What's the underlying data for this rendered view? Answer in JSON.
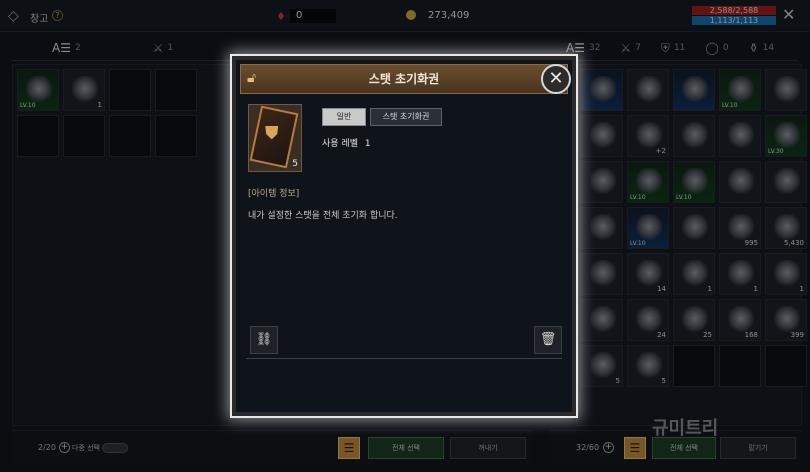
{
  "topbar": {
    "title": "창고",
    "help": "?",
    "ruby_value": "0",
    "gold_value": "273,409",
    "hp": "2,588/2,588",
    "mp": "1,113/1,113"
  },
  "left_tabs": [
    {
      "icon": "all-icon",
      "glyph": "A☰",
      "count": "2",
      "active": true
    },
    {
      "icon": "sword-icon",
      "glyph": "⚔",
      "count": "1",
      "active": false
    }
  ],
  "right_tabs": [
    {
      "icon": "all-icon",
      "glyph": "A☰",
      "count": "32",
      "active": true
    },
    {
      "icon": "sword-icon",
      "glyph": "⚔",
      "count": "7",
      "active": false
    },
    {
      "icon": "armor-icon",
      "glyph": "⛨",
      "count": "11",
      "active": false
    },
    {
      "icon": "ring-icon",
      "glyph": "◯",
      "count": "0",
      "active": false
    },
    {
      "icon": "potion-icon",
      "glyph": "⚱",
      "count": "14",
      "active": false
    }
  ],
  "left_items": [
    {
      "lv": "LV.10",
      "count": "",
      "tone": "green"
    },
    {
      "lv": "",
      "count": "1",
      "tone": "gray"
    }
  ],
  "right_items": [
    {
      "lv": "",
      "count": "",
      "tone": "blue"
    },
    {
      "lv": "",
      "count": "",
      "tone": "gray"
    },
    {
      "lv": "",
      "count": "",
      "tone": "blue"
    },
    {
      "lv": "LV.10",
      "count": "",
      "tone": "green"
    },
    {
      "lv": "",
      "count": "",
      "tone": "gray"
    },
    {
      "lv": "",
      "count": "",
      "tone": "gray"
    },
    {
      "lv": "",
      "count": "+2",
      "tone": "gray"
    },
    {
      "lv": "",
      "count": "",
      "tone": "gray"
    },
    {
      "lv": "",
      "count": "",
      "tone": "gray"
    },
    {
      "lv": "LV.30",
      "count": "",
      "tone": "green"
    },
    {
      "lv": "",
      "count": "",
      "tone": "gray"
    },
    {
      "lv": "LV.10",
      "count": "",
      "tone": "green"
    },
    {
      "lv": "LV.10",
      "count": "",
      "tone": "green"
    },
    {
      "lv": "",
      "count": "",
      "tone": "gray"
    },
    {
      "lv": "",
      "count": "",
      "tone": "gray"
    },
    {
      "lv": "",
      "count": "",
      "tone": "gray"
    },
    {
      "lv": "LV.10",
      "count": "",
      "tone": "blue"
    },
    {
      "lv": "",
      "count": "",
      "tone": "gray"
    },
    {
      "lv": "",
      "count": "995",
      "tone": "gray"
    },
    {
      "lv": "",
      "count": "5,430",
      "tone": "gray"
    },
    {
      "lv": "",
      "count": "",
      "tone": "gray"
    },
    {
      "lv": "",
      "count": "14",
      "tone": "gray"
    },
    {
      "lv": "",
      "count": "1",
      "tone": "gray"
    },
    {
      "lv": "",
      "count": "1",
      "tone": "gray"
    },
    {
      "lv": "",
      "count": "1",
      "tone": "gray"
    },
    {
      "lv": "",
      "count": "",
      "tone": "gray"
    },
    {
      "lv": "",
      "count": "24",
      "tone": "gray"
    },
    {
      "lv": "",
      "count": "25",
      "tone": "gray"
    },
    {
      "lv": "",
      "count": "168",
      "tone": "gray"
    },
    {
      "lv": "",
      "count": "399",
      "tone": "gray"
    },
    {
      "lv": "",
      "count": "5",
      "tone": "gray"
    },
    {
      "lv": "",
      "count": "5",
      "tone": "gray"
    }
  ],
  "left_bottom": {
    "capacity": "2/20",
    "multi_label": "다중 선택",
    "select_all": "전체 선택",
    "take_out": "꺼내기"
  },
  "right_bottom": {
    "capacity": "32/60",
    "select_all": "전체 선택",
    "store": "맡기기"
  },
  "modal": {
    "title": "스탯 초기화권",
    "item_count": "5",
    "grade_chip": "일반",
    "type_chip": "스탯 초기화권",
    "use_level_label": "사용 레벨",
    "use_level_value": "1",
    "info_header": "[아이템 정보]",
    "info_text": "내가 설정한 스탯을 전체 초기화 합니다."
  },
  "watermark": "규미트리",
  "colors": {
    "accent_gold": "#b8863a",
    "hp": "#9a1e1e",
    "mp": "#166aa8",
    "modal_header": "#6a4e2e"
  }
}
